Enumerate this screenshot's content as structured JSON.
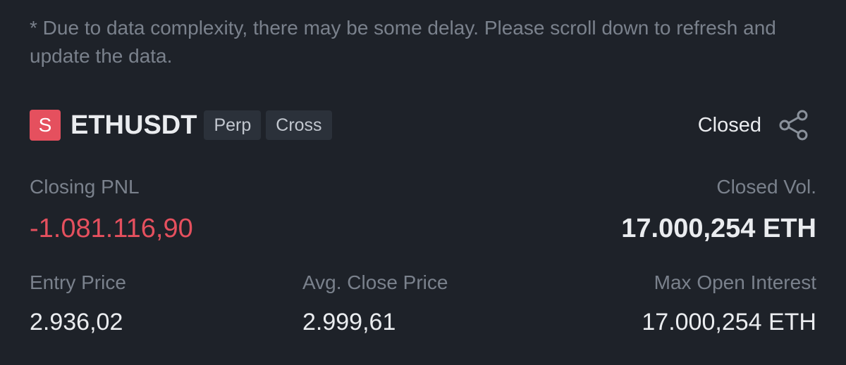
{
  "notice": "* Due to data complexity, there may be some delay. Please scroll down to refresh and update the data.",
  "position": {
    "side_badge": "S",
    "symbol": "ETHUSDT",
    "tags": [
      "Perp",
      "Cross"
    ],
    "status": "Closed",
    "share_icon": "share-icon"
  },
  "stats": {
    "closing_pnl_label": "Closing PNL",
    "closing_pnl_value": "-1.081.116,90",
    "closed_vol_label": "Closed Vol.",
    "closed_vol_value": "17.000,254 ETH",
    "entry_price_label": "Entry Price",
    "entry_price_value": "2.936,02",
    "avg_close_price_label": "Avg. Close Price",
    "avg_close_price_value": "2.999,61",
    "max_open_interest_label": "Max Open Interest",
    "max_open_interest_value": "17.000,254 ETH"
  },
  "colors": {
    "background": "#1e2229",
    "negative": "#e5505e",
    "muted_text": "#7a818c",
    "primary_text": "#eaecef",
    "tag_bg": "#2b313a"
  }
}
